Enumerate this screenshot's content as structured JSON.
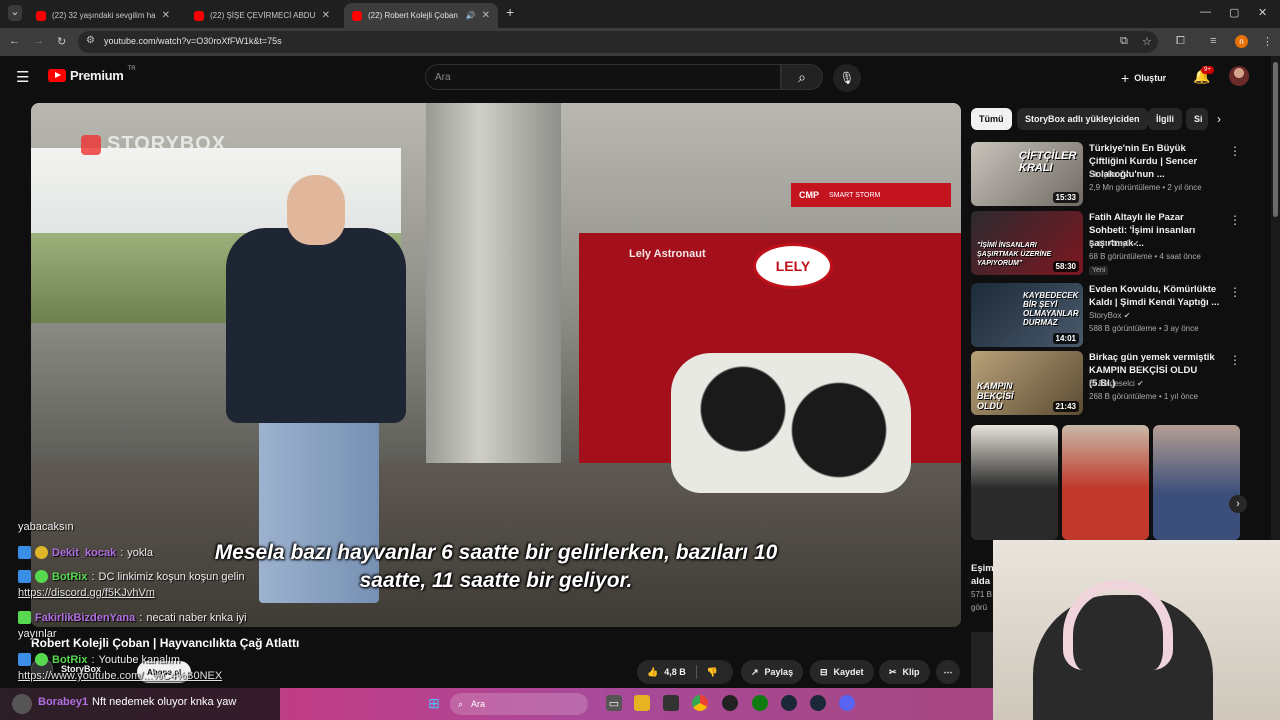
{
  "browser": {
    "tabs": [
      {
        "title": "(22) 32 yaşındaki sevgilim ham",
        "active": false
      },
      {
        "title": "(22) ŞİŞE ÇEVİRMECİ ABDURRA",
        "active": false
      },
      {
        "title": "(22) Robert Kolejli Çoban | H",
        "active": true
      }
    ],
    "url": "youtube.com/watch?v=O30roXfFW1k&t=75s",
    "profile_initial": "n"
  },
  "youtube": {
    "logo_text": "Premium",
    "logo_region": "TR",
    "search_placeholder": "Ara",
    "create_label": "Oluştur",
    "notification_count": "9+"
  },
  "player": {
    "watermark": "STORYBOX",
    "robot_label": "Lely Astronaut",
    "robot_brand": "LELY",
    "cmp_label": "CMP",
    "cmp_sub": "SMART STORM",
    "subtitle_line1": "Mesela bazı hayvanlar 6 saatte bir gelirlerken, bazıları 10",
    "subtitle_line2": "saatte, 11 saatte bir geliyor."
  },
  "video": {
    "title": "Robert Kolejli Çoban | Hayvancılıkta Çağ Atlattı",
    "channel": "StoryBox",
    "subscribe_label": "Abone ol",
    "likes": "4,8 B",
    "share_label": "Paylaş",
    "save_label": "Kaydet",
    "clip_label": "Klip"
  },
  "chat": [
    {
      "user": "",
      "text": "yabacaksın"
    },
    {
      "user": "Dekit_kocak",
      "text": "yokla"
    },
    {
      "user": "BotRix",
      "text": "DC linkimiz koşun koşun gelin"
    },
    {
      "user": "",
      "text": "https://discord.gg/f5KJvhVm"
    },
    {
      "user": "FakirlikBizdenYana",
      "text": "necati naber knka iyi"
    },
    {
      "user": "",
      "text": "yayınlar"
    },
    {
      "user": "BotRix",
      "text": "Youtube kanalım"
    },
    {
      "user": "",
      "text": "https://www.youtube.com/...%C4%B0NEX"
    },
    {
      "user": "Borabey1",
      "text": "Nft nedemek oluyor knka yaw"
    }
  ],
  "sidebar": {
    "chips": [
      "Tümü",
      "StoryBox adlı yükleyiciden",
      "İlgili",
      "Si"
    ],
    "recommendations": [
      {
        "title": "Türkiye'nin En Büyük Çiftliğini Kurdu | Sencer Solakoğlu'nun ...",
        "channel": "StoryBox",
        "meta": "2,9 Mn görüntüleme • 2 yıl önce",
        "duration": "15:33",
        "thumb_text": "ÇİFTÇİLER KRALI",
        "badge": ""
      },
      {
        "title": "Fatih Altaylı ile Pazar Sohbeti: 'İşimi insanları şaşırtmak ...",
        "channel": "Fatih Altaylı",
        "meta": "68 B görüntüleme • 4 saat önce",
        "duration": "58:30",
        "thumb_text": "\"İŞİMİ İNSANLARI ŞAŞIRTMAK ÜZERİNE YAPIYORUM\"",
        "badge": "Yeni"
      },
      {
        "title": "Evden Kovuldu, Kömürlükte Kaldı | Şimdi Kendi Yaptığı ...",
        "channel": "StoryBox",
        "meta": "588 B görüntüleme • 3 ay önce",
        "duration": "14:01",
        "thumb_text": "KAYBEDECEK BİR ŞEYİ OLMAYANLAR DURMAZ",
        "badge": ""
      },
      {
        "title": "Birkaç gün yemek vermiştik KAMPIN BEKÇİSİ OLDU (5.Bl.)",
        "channel": "Bi Belgeselci",
        "meta": "268 B görüntüleme • 1 yıl önce",
        "duration": "21:43",
        "thumb_text": "KAMPIN BEKÇİSİ OLDU",
        "badge": ""
      }
    ],
    "partial_items": [
      {
        "title": "Eşim",
        "sub": "alda",
        "meta": "571 B",
        "meta2": "görü"
      }
    ]
  },
  "taskbar": {
    "search_placeholder": "Ara"
  },
  "colors": {
    "yt_red": "#ff0000",
    "background": "#0f0f0f",
    "chat_green": "#56d84f",
    "chat_purple": "#b06fe0"
  }
}
